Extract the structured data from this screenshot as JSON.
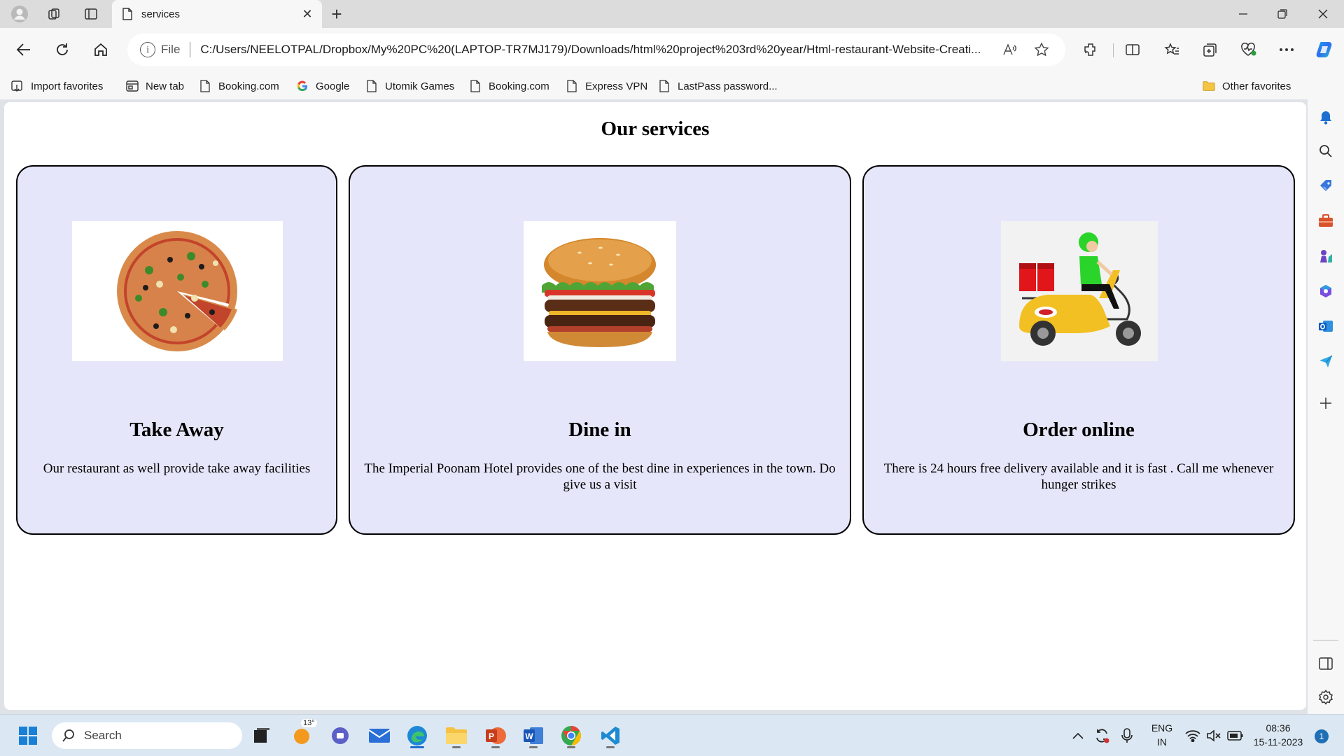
{
  "browser": {
    "tab_title": "services",
    "address": {
      "scheme_label": "File",
      "url": "C:/Users/NEELOTPAL/Dropbox/My%20PC%20(LAPTOP-TR7MJ179)/Downloads/html%20project%203rd%20year/Html-restaurant-Website-Creati..."
    },
    "favorites": [
      {
        "label": "Import favorites",
        "icon": "import-icon"
      },
      {
        "label": "New tab",
        "icon": "tab-icon"
      },
      {
        "label": "Booking.com",
        "icon": "page-icon"
      },
      {
        "label": "Google",
        "icon": "google-icon"
      },
      {
        "label": "Utomik Games",
        "icon": "page-icon"
      },
      {
        "label": "Booking.com",
        "icon": "page-icon"
      },
      {
        "label": "Express VPN",
        "icon": "page-icon"
      },
      {
        "label": "LastPass password...",
        "icon": "page-icon"
      }
    ],
    "other_favorites": "Other favorites"
  },
  "page": {
    "title": "Our services",
    "cards": [
      {
        "title": "Take Away",
        "text": "Our restaurant as well provide take away facilities",
        "image": "pizza"
      },
      {
        "title": "Dine in",
        "text": "The Imperial Poonam Hotel provides one of the best dine in experiences in the town. Do give us a visit",
        "image": "burger"
      },
      {
        "title": "Order online",
        "text": "There is 24 hours free delivery available and it is fast . Call me whenever hunger strikes",
        "image": "delivery-scooter"
      }
    ]
  },
  "taskbar": {
    "search_placeholder": "Search",
    "weather_temp": "13°",
    "language": "ENG",
    "region": "IN",
    "time": "08:36",
    "date": "15-11-2023",
    "notification_count": "1"
  },
  "colors": {
    "card_background": "#e6e6fa",
    "edge_accent": "#1f6fd1"
  }
}
